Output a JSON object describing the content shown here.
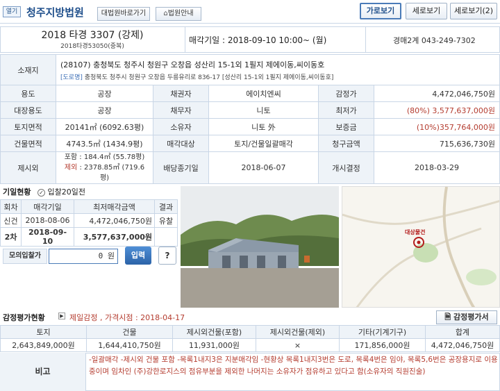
{
  "topbar": {
    "tag": "열기",
    "court": "청주지방법원",
    "shortcut": "대법원바로가기",
    "guide": "법원안내",
    "view_horizontal": "가로보기",
    "view_vertical": "세로보기",
    "view_vertical2": "세로보기(2)"
  },
  "header": {
    "case_no": "2018 타경 3307 (강제)",
    "case_sub": "2018타경53050(중복)",
    "sale_label": "매각기일",
    "sale_date": "2018-09-10 10:00~ (월)",
    "dept": "경매2계 043-249-7302"
  },
  "info": {
    "address_label": "소재지",
    "address_main": "(28107) 충청북도 청주시 청원구 오창읍 성산리 15-1외 1필지 제에이동,씨이동호",
    "address_road_tag": "[도로명]",
    "address_road": "충청북도 청주시 청원구 오창읍 두릉유리로 836-17 [성산리 15-1외 1필지 제에이동,씨이동호]",
    "rows": [
      {
        "l1": "용도",
        "v1": "공장",
        "l2": "채권자",
        "v2": "에이치엔씨",
        "l3": "감정가",
        "v3": "4,472,046,750원"
      },
      {
        "l1": "대장용도",
        "v1": "공장",
        "l2": "채무자",
        "v2": "니토",
        "l3": "최저가",
        "v3": "(80%) 3,577,637,000원"
      },
      {
        "l1": "토지면적",
        "v1": "20141㎡ (6092.63평)",
        "l2": "소유자",
        "v2": "니토 外",
        "l3": "보증금",
        "v3": "(10%)357,764,000원"
      },
      {
        "l1": "건물면적",
        "v1": "4743.5㎡ (1434.9평)",
        "l2": "매각대상",
        "v2": "토지/건물일괄매각",
        "l3": "청구금액",
        "v3": "715,636,730원"
      }
    ],
    "extra_label": "제시외",
    "extra_incl": "포함 : 184.4㎡ (55.78평)",
    "extra_excl_tag": "제외",
    "extra_excl": " : 2378.85㎡ (719.6평)",
    "dist_label": "배당종기일",
    "dist_date": "2018-06-07",
    "start_label": "개시결정",
    "start_date": "2018-03-29"
  },
  "history": {
    "title": "기일현황",
    "days_note": "입찰20일전",
    "headers": [
      "회차",
      "매각기일",
      "최저매각금액",
      "결과"
    ],
    "rows": [
      [
        "신건",
        "2018-08-06",
        "4,472,046,750원",
        "유찰"
      ],
      [
        "2차",
        "2018-09-10",
        "3,577,637,000원",
        ""
      ]
    ],
    "mock_label": "모의입찰가",
    "mock_value": "0 원",
    "mock_btn": "입력",
    "help": "?"
  },
  "map": {
    "place_label": "대상물건"
  },
  "appraisal": {
    "title": "감정평가현황",
    "detail": "제일감정 , 가격시점 : 2018-04-17",
    "doc_btn": "감정평가서",
    "headers": [
      "토지",
      "건물",
      "제시외건물(포함)",
      "제시외건물(제외)",
      "기타(기계기구)",
      "합계"
    ],
    "values": [
      "2,643,849,000원",
      "1,644,410,750원",
      "11,931,000원",
      "×",
      "171,856,000원",
      "4,472,046,750원"
    ],
    "note_label": "비고",
    "note": "-일괄매각 -제시외 건물 포함 -목록1내지3은 지분매각임 -현황상 목록1내지3번은 도로, 목록4번은 임야, 목록5,6번은 공장용지로 이용중이며 임차인 (주)강한로지스의 점유부분을 제외한 나머지는 소유자가 점유하고 있다고 함(소유자의 직원진술)"
  },
  "colors": {
    "accent": "#1f4f8b",
    "label_bg": "#eef3f8",
    "border": "#c9d6e6",
    "red": "#b43c2f"
  }
}
